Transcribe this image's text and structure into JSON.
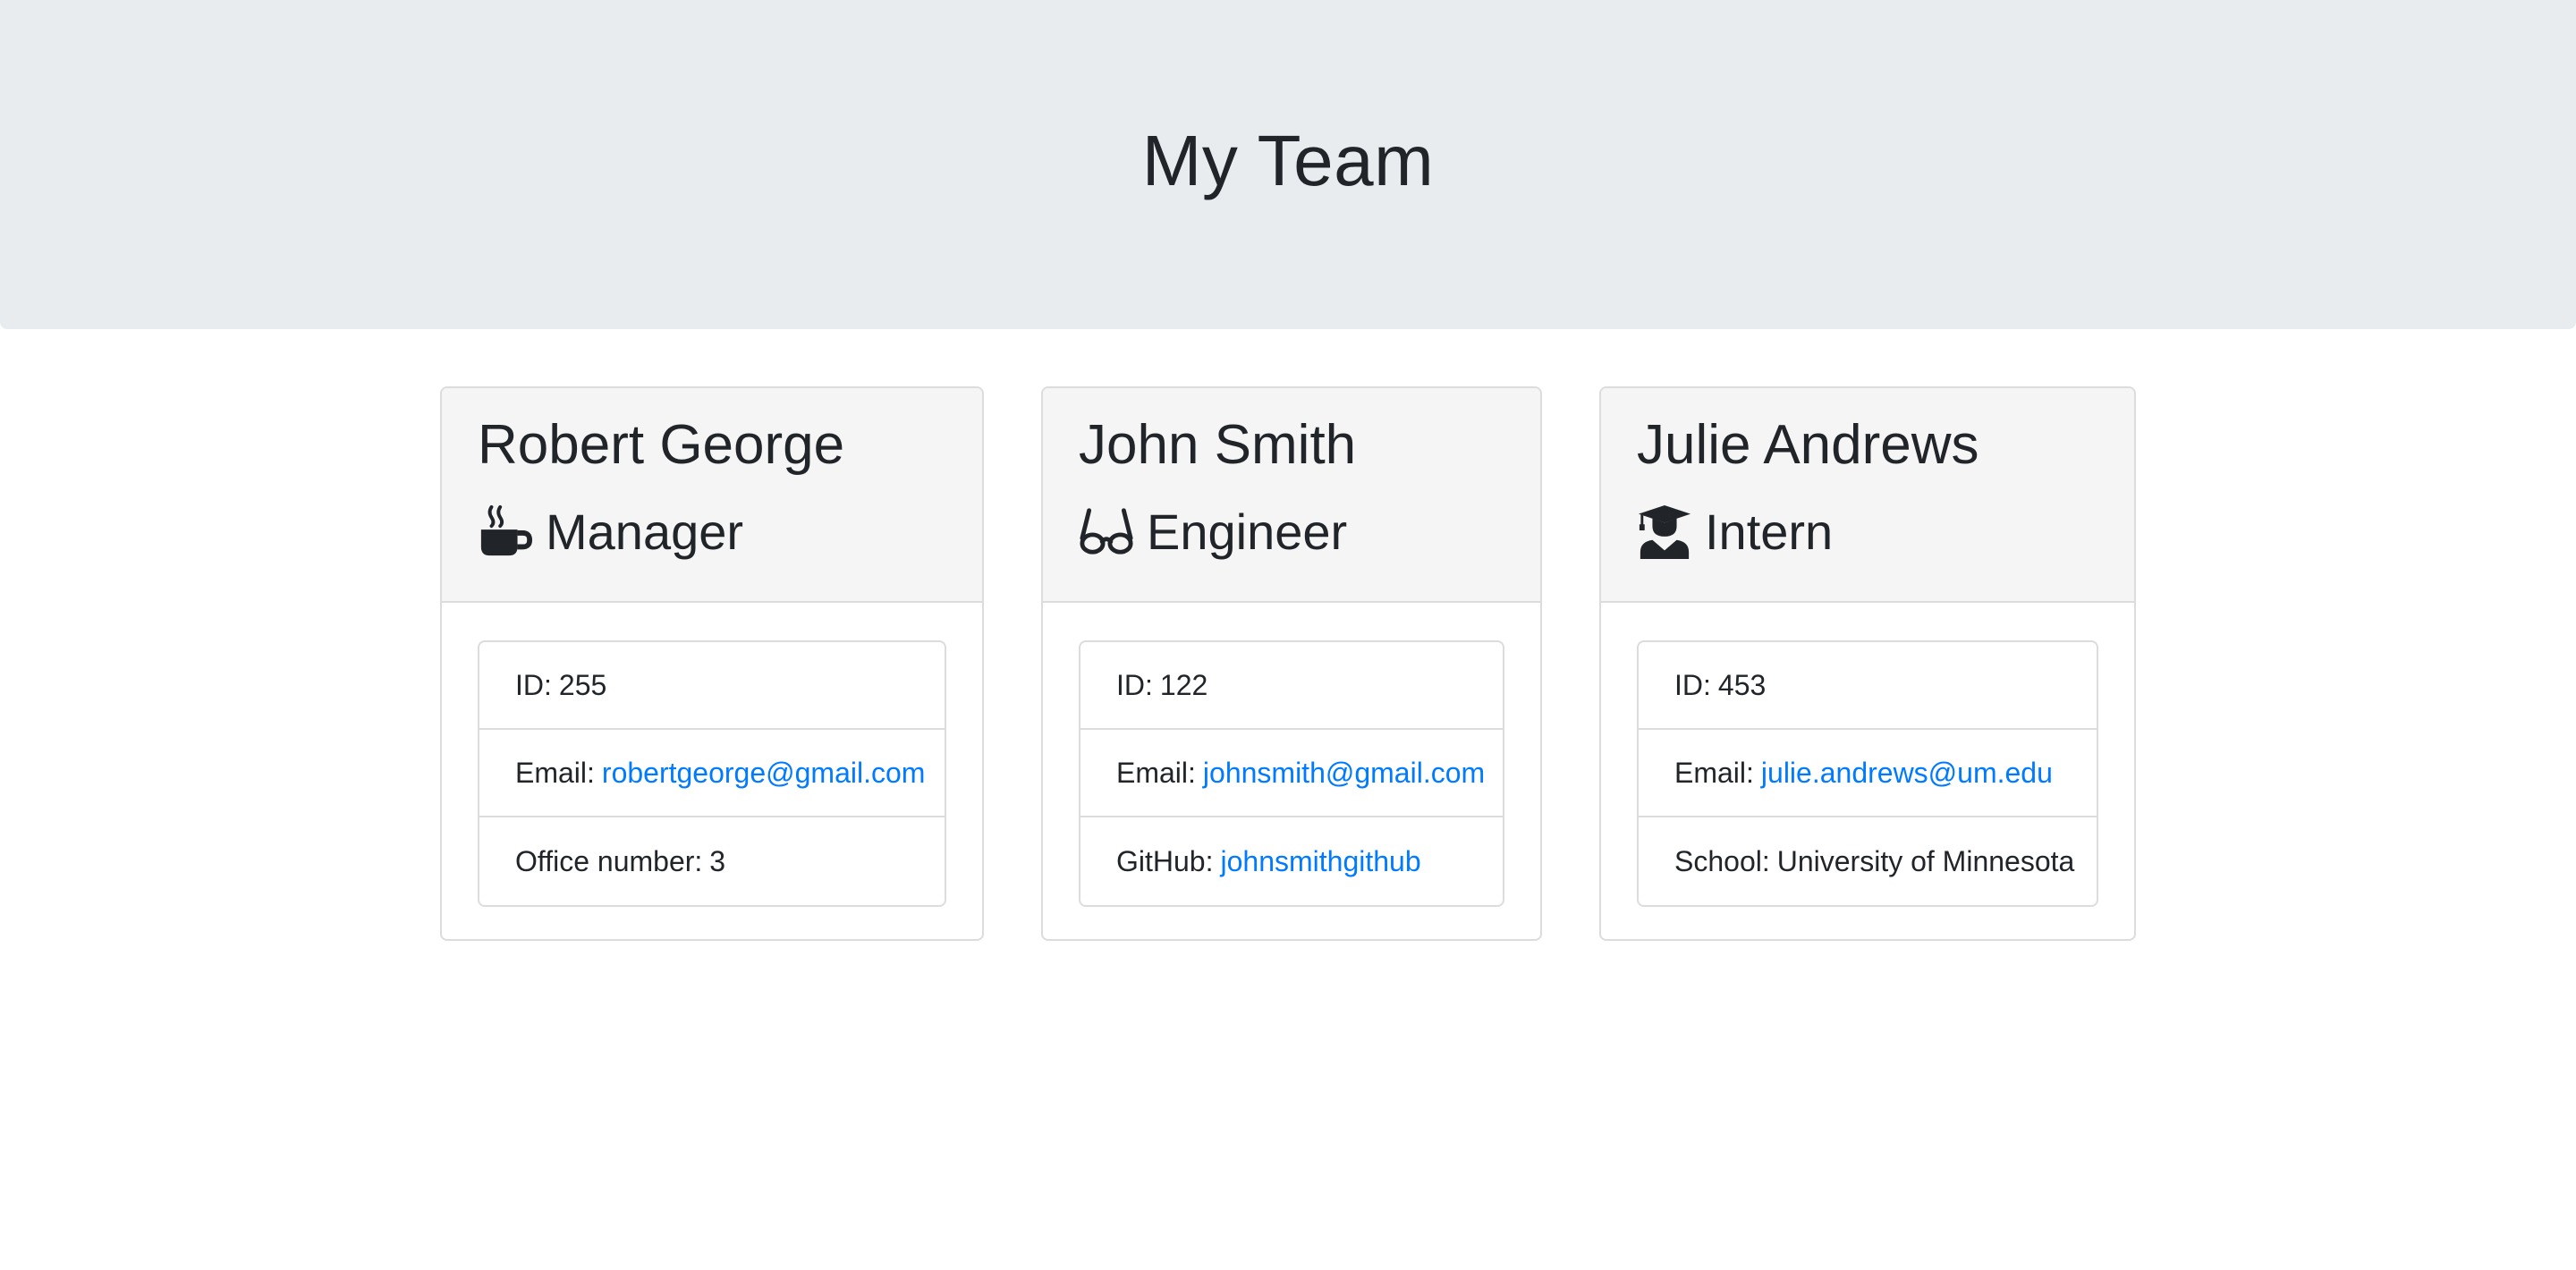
{
  "header": {
    "title": "My Team"
  },
  "team": [
    {
      "name": "Robert George",
      "role": "Manager",
      "role_icon": "coffee-icon",
      "id_label": "ID:",
      "id": "255",
      "email_label": "Email:",
      "email": "robertgeorge@gmail.com",
      "extra_label": "Office number:",
      "extra_value": "3"
    },
    {
      "name": "John Smith",
      "role": "Engineer",
      "role_icon": "glasses-icon",
      "id_label": "ID:",
      "id": "122",
      "email_label": "Email:",
      "email": "johnsmith@gmail.com",
      "extra_label": "GitHub:",
      "extra_value": "johnsmithgithub"
    },
    {
      "name": "Julie Andrews",
      "role": "Intern",
      "role_icon": "graduate-icon",
      "id_label": "ID:",
      "id": "453",
      "email_label": "Email:",
      "email": "julie.andrews@um.edu",
      "extra_label": "School:",
      "extra_value": "University of Minnesota"
    }
  ],
  "colors": {
    "link": "#007bff",
    "header_bg": "#e9ecef",
    "card_header_bg": "#f5f5f5",
    "text": "#212529"
  }
}
